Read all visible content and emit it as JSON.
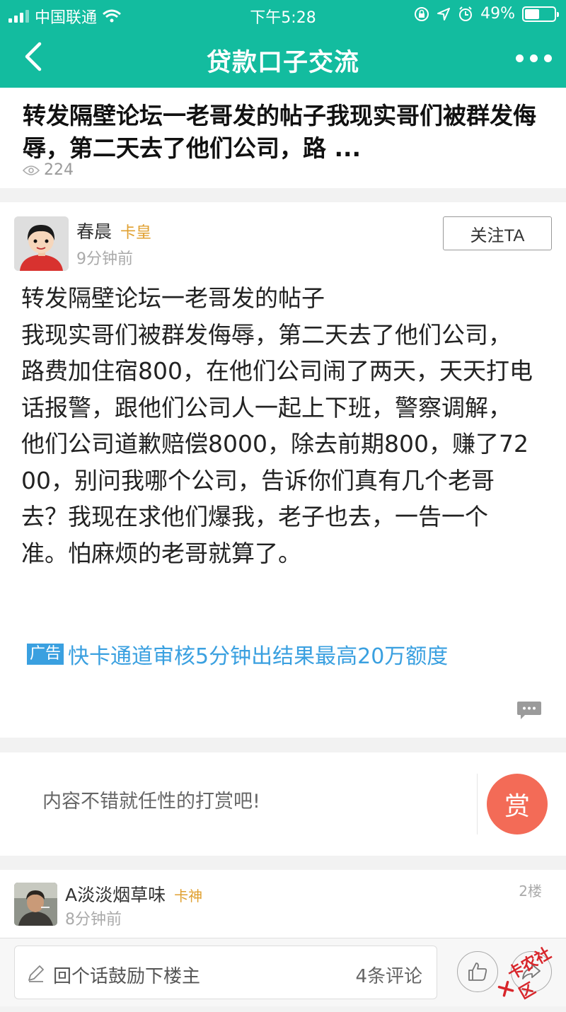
{
  "status_bar": {
    "carrier": "中国联通",
    "time": "下午5:28",
    "battery": "49%",
    "battery_level": 0.49,
    "icons": [
      "signal-icon",
      "wifi-icon",
      "orientation-lock-icon",
      "location-icon",
      "alarm-icon",
      "battery-icon"
    ]
  },
  "nav": {
    "title": "贷款口子交流",
    "back_icon": "chevron-left-icon",
    "more_icon": "more-dots-icon"
  },
  "post": {
    "title": "转发隔壁论坛一老哥发的帖子我现实哥们被群发侮辱，第二天去了他们公司，路 ...",
    "views": "224",
    "author": "春晨",
    "author_rank": "卡皇",
    "time": "9分钟前",
    "follow_label": "关注TA",
    "content": "转发隔壁论坛一老哥发的帖子\n我现实哥们被群发侮辱，第二天去了他们公司，路费加住宿800，在他们公司闹了两天，天天打电话报警，跟他们公司人一起上下班，警察调解，他们公司道歉赔偿8000，除去前期800，赚了7200，别问我哪个公司，告诉你们真有几个老哥去？我现在求他们爆我，老子也去，一告一个准。怕麻烦的老哥就算了。",
    "ad_badge": "广告",
    "ad_text": "快卡通道审核5分钟出结果最高20万额度"
  },
  "reward": {
    "text": "内容不错就任性的打赏吧!",
    "button": "赏"
  },
  "reply": {
    "author": "A淡淡烟草味",
    "author_rank": "卡神",
    "time": "8分钟前",
    "floor": "2楼"
  },
  "bottom_bar": {
    "reply_placeholder": "回个话鼓励下楼主",
    "comment_count": "4条评论"
  },
  "watermark": "卡农社区",
  "colors": {
    "header": "#13bc9f",
    "rank": "#e0a030",
    "ad": "#3aa0e0",
    "reward": "#f36b57"
  }
}
